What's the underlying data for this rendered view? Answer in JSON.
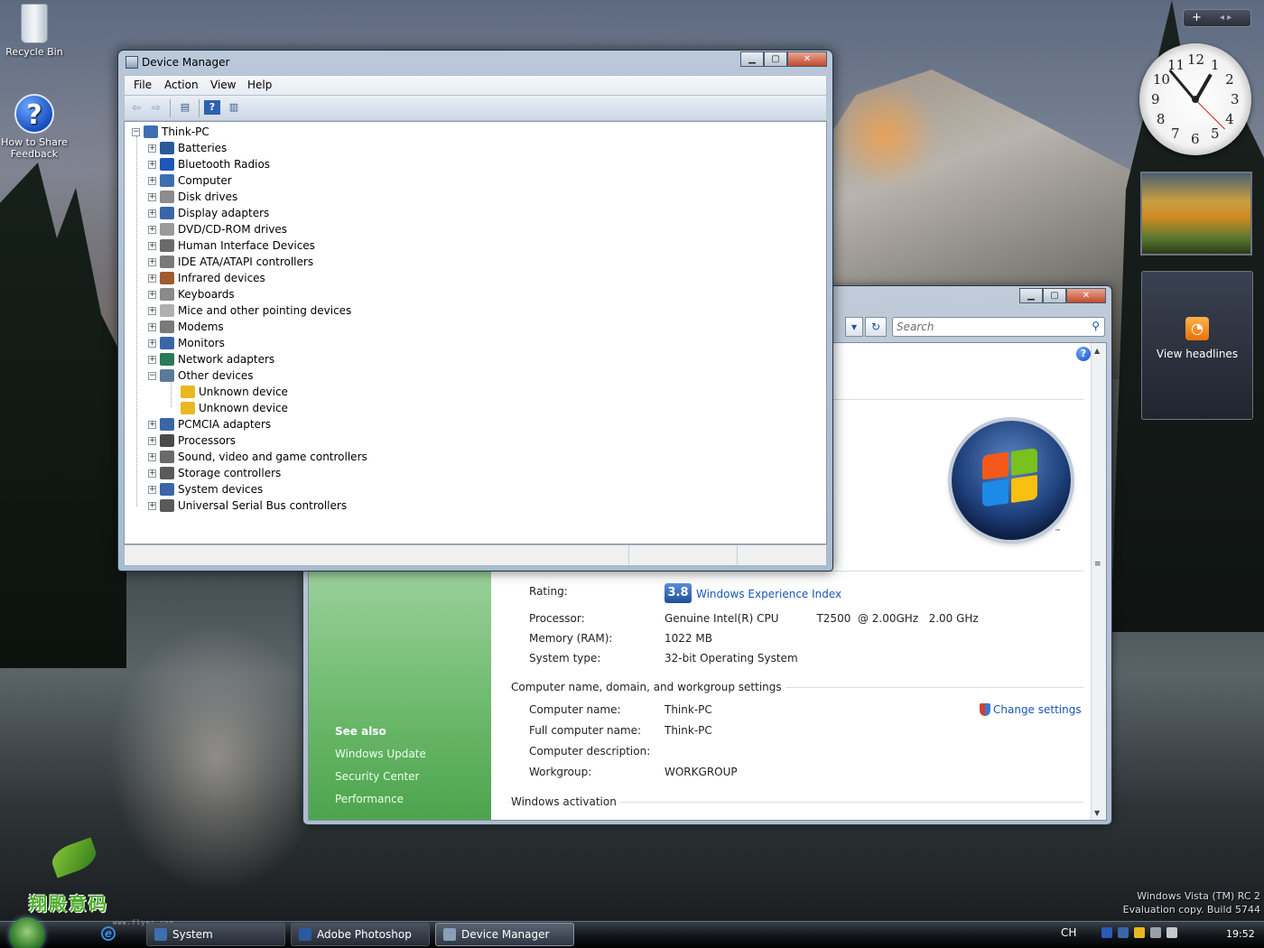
{
  "desktop": {
    "icons": [
      {
        "label": "Recycle Bin"
      },
      {
        "label": "How to Share Feedback"
      }
    ],
    "watermark": {
      "line1": "Windows Vista (TM) RC 2",
      "line2": "Evaluation copy. Build 5744"
    }
  },
  "sidebar": {
    "add_label": "+",
    "nav_label": "◂ ▸",
    "clock_numbers": [
      "12",
      "1",
      "2",
      "3",
      "4",
      "5",
      "6",
      "7",
      "8",
      "9",
      "10",
      "11"
    ],
    "feed_label": "View headlines",
    "feed_icon": "rss-icon"
  },
  "device_manager": {
    "title": "Device Manager",
    "caption_buttons": [
      "minimize",
      "maximize",
      "close"
    ],
    "menu": [
      "File",
      "Action",
      "View",
      "Help"
    ],
    "toolbar_icons": [
      "back-icon",
      "forward-icon",
      "properties-icon",
      "help-icon",
      "show-hide-console-tree-icon"
    ],
    "root": "Think-PC",
    "categories": [
      {
        "label": "Batteries",
        "icon": "battery-icon",
        "color": "#2a5a9a"
      },
      {
        "label": "Bluetooth Radios",
        "icon": "bluetooth-icon",
        "color": "#1f56b8"
      },
      {
        "label": "Computer",
        "icon": "computer-icon",
        "color": "#3e6eb0"
      },
      {
        "label": "Disk drives",
        "icon": "disk-drive-icon",
        "color": "#8c8c8c"
      },
      {
        "label": "Display adapters",
        "icon": "display-adapter-icon",
        "color": "#3a66a8"
      },
      {
        "label": "DVD/CD-ROM drives",
        "icon": "dvd-drive-icon",
        "color": "#9a9a9a"
      },
      {
        "label": "Human Interface Devices",
        "icon": "hid-icon",
        "color": "#6a6a6a"
      },
      {
        "label": "IDE ATA/ATAPI controllers",
        "icon": "ide-controller-icon",
        "color": "#7a7a7a"
      },
      {
        "label": "Infrared devices",
        "icon": "infrared-icon",
        "color": "#a05a30"
      },
      {
        "label": "Keyboards",
        "icon": "keyboard-icon",
        "color": "#8a8a8a"
      },
      {
        "label": "Mice and other pointing devices",
        "icon": "mouse-icon",
        "color": "#b0b0b0"
      },
      {
        "label": "Modems",
        "icon": "modem-icon",
        "color": "#7a7a7a"
      },
      {
        "label": "Monitors",
        "icon": "monitor-icon",
        "color": "#3a66a8"
      },
      {
        "label": "Network adapters",
        "icon": "network-adapter-icon",
        "color": "#2a7a5a"
      },
      {
        "label": "Other devices",
        "icon": "other-devices-icon",
        "color": "#5a7a9a",
        "expanded": true,
        "children": [
          {
            "label": "Unknown device",
            "icon": "unknown-device-warning-icon",
            "color": "#e8b820"
          },
          {
            "label": "Unknown device",
            "icon": "unknown-device-warning-icon",
            "color": "#e8b820"
          }
        ]
      },
      {
        "label": "PCMCIA adapters",
        "icon": "pcmcia-icon",
        "color": "#3a66a8"
      },
      {
        "label": "Processors",
        "icon": "processor-icon",
        "color": "#4a4a4a"
      },
      {
        "label": "Sound, video and game controllers",
        "icon": "speaker-icon",
        "color": "#6a6a6a"
      },
      {
        "label": "Storage controllers",
        "icon": "storage-controller-icon",
        "color": "#5a5a5a"
      },
      {
        "label": "System devices",
        "icon": "system-devices-icon",
        "color": "#3a66a8"
      },
      {
        "label": "Universal Serial Bus controllers",
        "icon": "usb-icon",
        "color": "#5a5a5a"
      }
    ]
  },
  "system_window": {
    "search_placeholder": "Search",
    "see_also": "See also",
    "see_also_links": [
      "Windows Update",
      "Security Center",
      "Performance"
    ],
    "rating_label": "Rating:",
    "rating_value": "3.8",
    "rating_link": "Windows Experience Index",
    "rows": [
      {
        "label": "Processor:",
        "value": "Genuine Intel(R) CPU           T2500  @ 2.00GHz   2.00 GHz"
      },
      {
        "label": "Memory (RAM):",
        "value": "1022 MB"
      },
      {
        "label": "System type:",
        "value": "32-bit Operating System"
      }
    ],
    "computer_section": "Computer name, domain, and workgroup settings",
    "computer_rows": [
      {
        "label": "Computer name:",
        "value": "Think-PC"
      },
      {
        "label": "Full computer name:",
        "value": "Think-PC"
      },
      {
        "label": "Computer description:",
        "value": ""
      },
      {
        "label": "Workgroup:",
        "value": "WORKGROUP"
      }
    ],
    "change_settings": "Change settings",
    "activation_section": "Windows activation",
    "logo_mark": "™"
  },
  "taskbar": {
    "buttons": [
      {
        "label": "System"
      },
      {
        "label": "Adobe Photoshop"
      },
      {
        "label": "Device Manager",
        "active": true
      }
    ],
    "language": "CH",
    "time": "19:52"
  },
  "overlay": {
    "stamp_text": "翔殿意码",
    "stamp_url": "www.flyer.com"
  }
}
